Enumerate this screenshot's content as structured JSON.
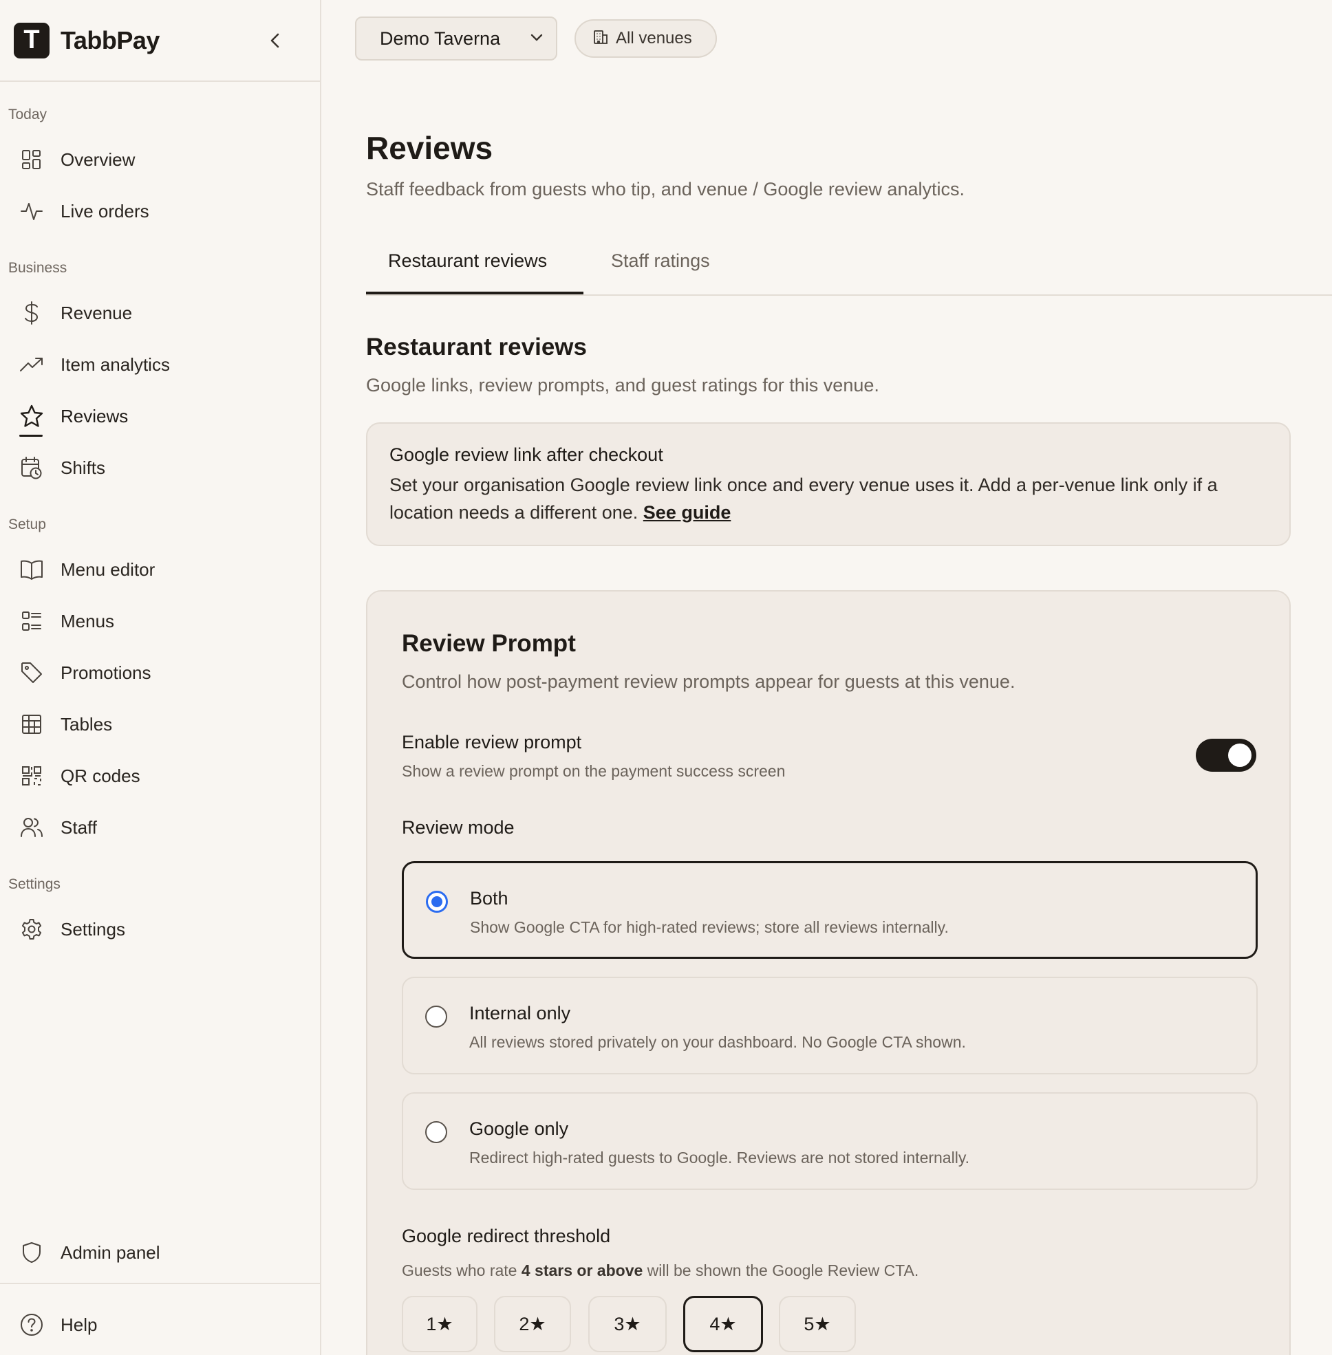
{
  "brand": {
    "logo_letter": "T",
    "name": "TabbPay"
  },
  "sidebar": {
    "sections": [
      {
        "title": "Today"
      },
      {
        "title": "Business"
      },
      {
        "title": "Setup"
      },
      {
        "title": "Settings"
      }
    ],
    "items": [
      {
        "label": "Overview",
        "icon": "grid-icon"
      },
      {
        "label": "Live orders",
        "icon": "activity-icon"
      },
      {
        "label": "Revenue",
        "icon": "dollar-icon"
      },
      {
        "label": "Item analytics",
        "icon": "trending-up-icon"
      },
      {
        "label": "Reviews",
        "icon": "star-icon",
        "active": true
      },
      {
        "label": "Shifts",
        "icon": "calendar-clock-icon"
      },
      {
        "label": "Menu editor",
        "icon": "book-open-icon"
      },
      {
        "label": "Menus",
        "icon": "list-icon"
      },
      {
        "label": "Promotions",
        "icon": "tag-icon"
      },
      {
        "label": "Tables",
        "icon": "table-icon"
      },
      {
        "label": "QR codes",
        "icon": "qr-code-icon"
      },
      {
        "label": "Staff",
        "icon": "users-icon"
      },
      {
        "label": "Settings",
        "icon": "gear-icon"
      }
    ],
    "admin_panel": "Admin panel",
    "help": "Help"
  },
  "topbar": {
    "venue": "Demo Taverna",
    "all_venues": "All venues"
  },
  "page": {
    "title": "Reviews",
    "subtitle": "Staff feedback from guests who tip, and venue / Google review analytics.",
    "tabs": [
      {
        "label": "Restaurant reviews",
        "active": true
      },
      {
        "label": "Staff ratings",
        "active": false
      }
    ]
  },
  "section": {
    "title": "Restaurant reviews",
    "subtitle": "Google links, review prompts, and guest ratings for this venue."
  },
  "info_card": {
    "title": "Google review link after checkout",
    "body": "Set your organisation Google review link once and every venue uses it. Add a per-venue link only if a location needs a different one.",
    "link": "See guide"
  },
  "review_prompt": {
    "title": "Review Prompt",
    "subtitle": "Control how post-payment review prompts appear for guests at this venue.",
    "toggle_label": "Enable review prompt",
    "toggle_desc": "Show a review prompt on the payment success screen",
    "toggle_on": true,
    "mode_label": "Review mode",
    "modes": [
      {
        "title": "Both",
        "desc": "Show Google CTA for high-rated reviews; store all reviews internally.",
        "selected": true
      },
      {
        "title": "Internal only",
        "desc": "All reviews stored privately on your dashboard. No Google CTA shown.",
        "selected": false
      },
      {
        "title": "Google only",
        "desc": "Redirect high-rated guests to Google. Reviews are not stored internally.",
        "selected": false
      }
    ],
    "threshold_label": "Google redirect threshold",
    "threshold_desc_prefix": "Guests who rate",
    "threshold_desc_bold": "4 stars or above",
    "threshold_desc_suffix": "will be shown the Google Review CTA.",
    "threshold_options": [
      "1★",
      "2★",
      "3★",
      "4★",
      "5★"
    ],
    "threshold_selected": "4★"
  },
  "colors": {
    "accent": "#2b6cf0",
    "ink": "#1f1b17",
    "background": "#f9f6f2",
    "card": "#f1ebe5"
  }
}
